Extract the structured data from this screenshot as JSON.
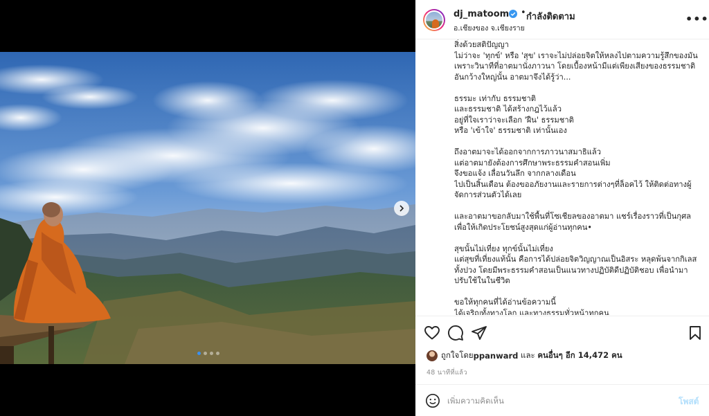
{
  "post": {
    "username": "dj_matoom",
    "bullet": "•",
    "follow_status": "กำลังติดตาม",
    "location": "อ.เชียงของ จ.เชียงราย",
    "more": "•••"
  },
  "media": {
    "alt": "monk meditating facing mountain landscape",
    "slide_count": 4,
    "active_slide": 1
  },
  "caption": {
    "lines": [
      "สิ่งด้วยสติปัญญา",
      "ไม่ว่าจะ 'ทุกข์' หรือ 'สุข' เราจะไม่ปล่อยจิตให้หลงไปตามความรู้สึกของมัน",
      "เพราะวินาทีที่อาตมานั่งภาวนา โดยเบื้องหน้ามีแต่เพียงเสียงของธรรมชาติ",
      "อันกว้างใหญ่นั้น อาตมาจึงได้รู้ว่า...",
      "",
      "ธรรมะ เท่ากับ ธรรมชาติ",
      "และธรรมชาติ ได้สร้างกฎไว้แล้ว",
      "อยู่ที่ใจเราว่าจะเลือก 'ฝืน' ธรรมชาติ",
      "หรือ 'เข้าใจ' ธรรมชาติ เท่านั้นเอง",
      "",
      "ถึงอาตมาจะได้ออกจากการภาวนาสมาธิแล้ว",
      "แต่อาตมายังต้องการศึกษาพระธรรมคำสอนเพิ่ม",
      "จึงขอแจ้ง เลื่อนวันลึก จากกลางเดือน",
      "ไปเป็นสิ้นเดือน ต้องขออภัยงานและรายการต่างๆที่ล็อคไว้ ให้ติดต่อทางผู้",
      "จัดการส่วนตัวได้เลย",
      "",
      "และอาตมาขอกลับมาใช้พื้นที่โซเชียลของอาตมา แชร์เรื่องราวที่เป็นกุศล",
      "เพื่อให้เกิดประโยชน์สูงสุดแก่ผู้อ่านทุกคน•",
      "",
      "สุขนั้นไม่เที่ยง ทุกข์นั้นไม่เที่ยง",
      "แต่สุขที่เที่ยงแท้นั้น คือการได้ปล่อยจิตวิญญาณเป็นอิสระ หลุดพ้นจากกิเลส",
      "ทั้งปวง โดยมีพระธรรมคำสอนเป็นแนวทางปฏิบัติดีปฏิบัติชอบ เพื่อนำมา",
      "ปรับใช้ในในชีวิต",
      "",
      "ขอให้ทุกคนที่ได้อ่านข้อความนี้",
      "ได้เจริญทั้งทางโลก และทางธรรมทั่วหน้าทุกคน"
    ]
  },
  "likes": {
    "prefix": "ถูกใจโดย ",
    "user": "ppanward",
    "connector": " และ ",
    "others": "คนอื่นๆ อีก 14,472 คน"
  },
  "timestamp": "48 นาทีที่แล้ว",
  "comment": {
    "placeholder": "เพิ่มความคิดเห็น",
    "post_label": "โพสต์"
  },
  "colors": {
    "accent": "#0095f6",
    "post_disabled": "#b2dffc",
    "verified": "#3897f0",
    "robe": "#d66a1e"
  }
}
